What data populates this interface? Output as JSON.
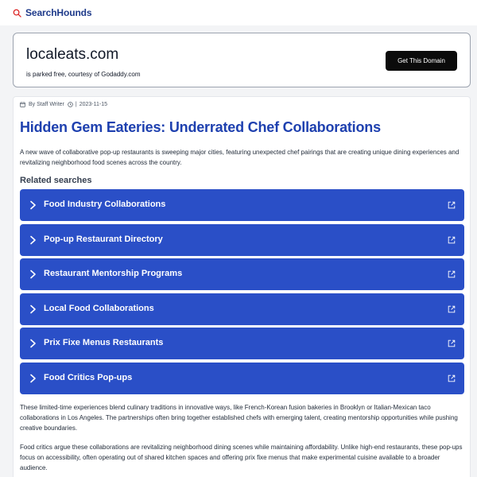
{
  "header": {
    "brand_name": "SearchHounds",
    "brand_icon": "search-icon"
  },
  "domain_card": {
    "domain": "localeats.com",
    "note": "is parked free, courtesy of Godaddy.com",
    "cta_label": "Get This Domain"
  },
  "article": {
    "author": "By Staff Writer",
    "separator": "|",
    "date": "2023-11-15",
    "title": "Hidden Gem Eateries: Underrated Chef Collaborations",
    "intro": "A new wave of collaborative pop-up restaurants is sweeping major cities, featuring unexpected chef pairings that are creating unique dining experiences and revitalizing neighborhood food scenes across the country.",
    "related_heading": "Related searches",
    "related_searches": [
      {
        "label": "Food Industry Collaborations"
      },
      {
        "label": "Pop-up Restaurant Directory"
      },
      {
        "label": "Restaurant Mentorship Programs"
      },
      {
        "label": "Local Food Collaborations"
      },
      {
        "label": "Prix Fixe Menus Restaurants"
      },
      {
        "label": "Food Critics Pop-ups"
      }
    ],
    "paragraphs": [
      "These limited-time experiences blend culinary traditions in innovative ways, like French-Korean fusion bakeries in Brooklyn or Italian-Mexican taco collaborations in Los Angeles. The partnerships often bring together established chefs with emerging talent, creating mentorship opportunities while pushing creative boundaries.",
      "Food critics argue these collaborations are revitalizing neighborhood dining scenes while maintaining affordability. Unlike high-end restaurants, these pop-ups focus on accessibility, often operating out of shared kitchen spaces and offering prix fixe menus that make experimental cuisine available to a broader audience."
    ]
  },
  "colors": {
    "accent": "#2a4fc7",
    "title": "#1e40af",
    "brand": "#1e3a8a",
    "brand_icon": "#dc2626",
    "button": "#0b0b0b"
  }
}
